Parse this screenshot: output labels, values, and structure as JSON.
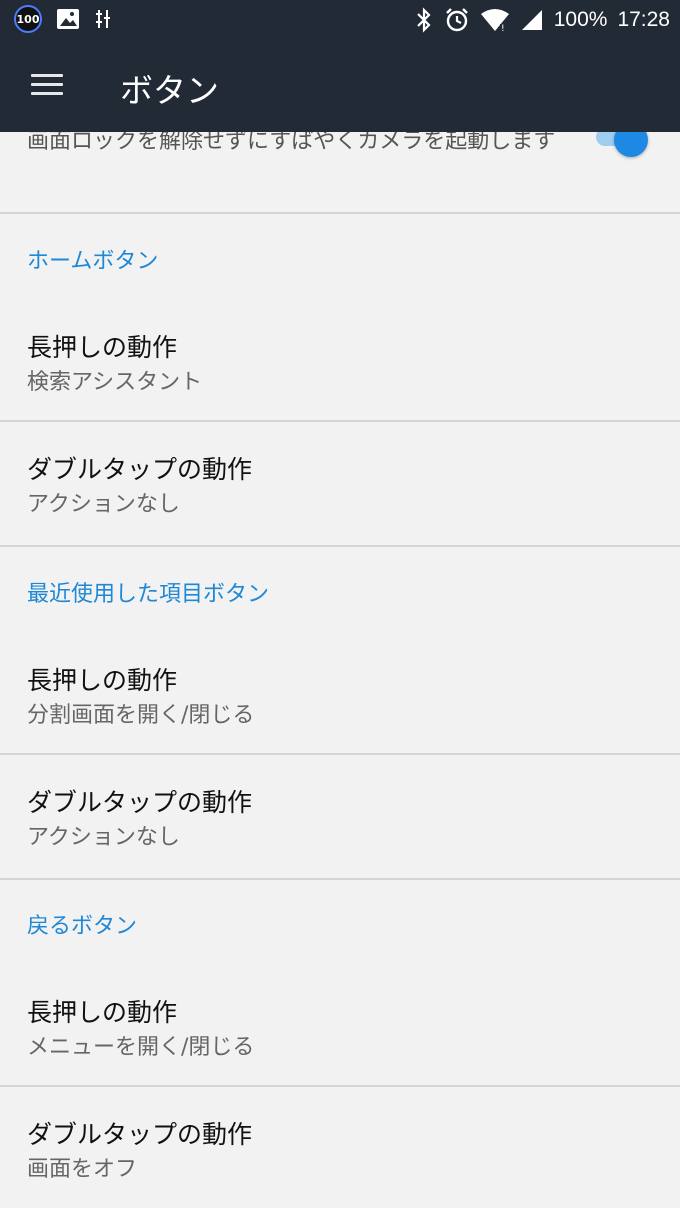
{
  "status_bar": {
    "badge": "100",
    "battery": "100%",
    "time": "17:28"
  },
  "app_bar": {
    "title": "ボタン"
  },
  "camera_setting": {
    "description": "画面ロックを解除せずにすばやくカメラを起動します",
    "enabled": true
  },
  "sections": [
    {
      "header": "ホームボタン",
      "items": [
        {
          "title": "長押しの動作",
          "value": "検索アシスタント"
        },
        {
          "title": "ダブルタップの動作",
          "value": "アクションなし"
        }
      ]
    },
    {
      "header": "最近使用した項目ボタン",
      "items": [
        {
          "title": "長押しの動作",
          "value": "分割画面を開く/閉じる"
        },
        {
          "title": "ダブルタップの動作",
          "value": "アクションなし"
        }
      ]
    },
    {
      "header": "戻るボタン",
      "items": [
        {
          "title": "長押しの動作",
          "value": "メニューを開く/閉じる"
        },
        {
          "title": "ダブルタップの動作",
          "value": "画面をオフ"
        }
      ]
    }
  ],
  "colors": {
    "bar_bg": "#222a35",
    "accent": "#1e88d6",
    "page_bg": "#f2f2f2"
  }
}
